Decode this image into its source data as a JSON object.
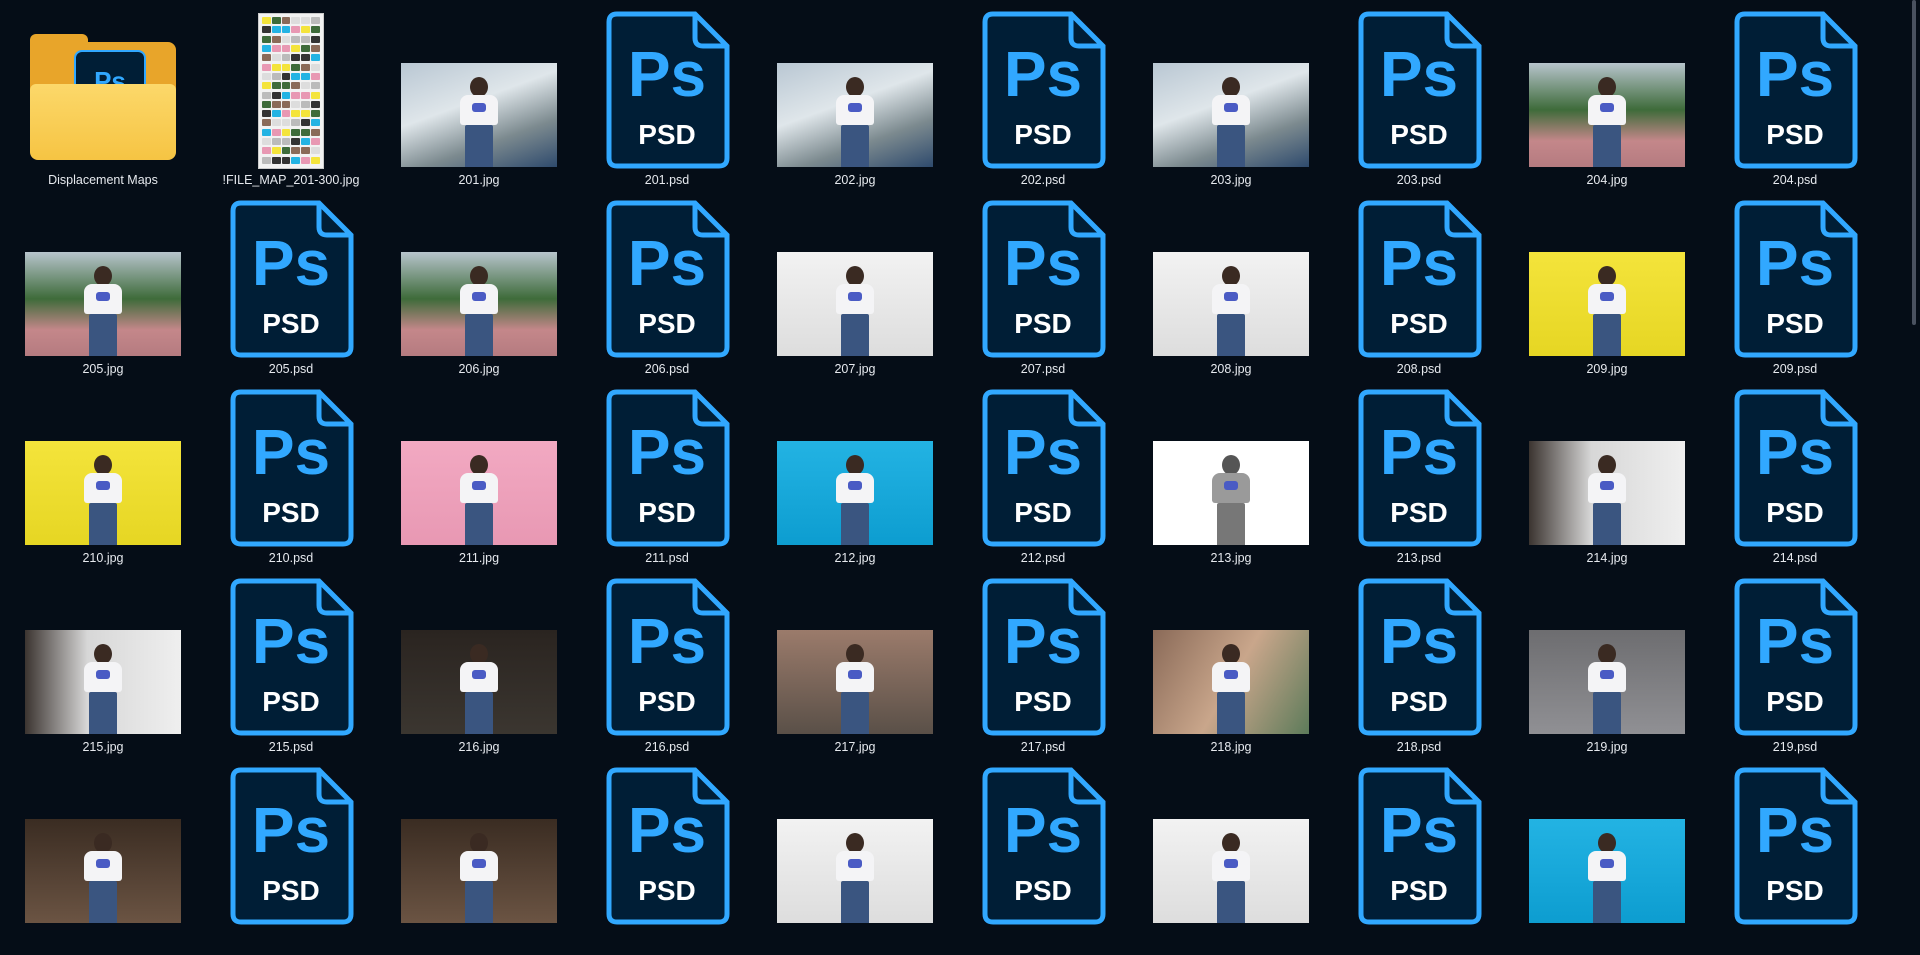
{
  "colors": {
    "background": "#050d17",
    "psd_blue": "#31a8ff",
    "psd_dark": "#001e36",
    "folder_yellow": "#f6c443"
  },
  "psd_icon": {
    "logo_text": "Ps",
    "type_text": "PSD"
  },
  "items": [
    {
      "name": "Displacement Maps",
      "kind": "folder",
      "icon": "ps-folder-icon"
    },
    {
      "name": "!FILE_MAP_201-300.jpg",
      "kind": "filemap"
    },
    {
      "name": "201.jpg",
      "kind": "photo",
      "bg": "ferris"
    },
    {
      "name": "201.psd",
      "kind": "psd"
    },
    {
      "name": "202.jpg",
      "kind": "photo",
      "bg": "ferris"
    },
    {
      "name": "202.psd",
      "kind": "psd"
    },
    {
      "name": "203.jpg",
      "kind": "photo",
      "bg": "ferris"
    },
    {
      "name": "203.psd",
      "kind": "psd"
    },
    {
      "name": "204.jpg",
      "kind": "photo",
      "bg": "park"
    },
    {
      "name": "204.psd",
      "kind": "psd"
    },
    {
      "name": "205.jpg",
      "kind": "photo",
      "bg": "park"
    },
    {
      "name": "205.psd",
      "kind": "psd"
    },
    {
      "name": "206.jpg",
      "kind": "photo",
      "bg": "park"
    },
    {
      "name": "206.psd",
      "kind": "psd"
    },
    {
      "name": "207.jpg",
      "kind": "photo",
      "bg": "white"
    },
    {
      "name": "207.psd",
      "kind": "psd"
    },
    {
      "name": "208.jpg",
      "kind": "photo",
      "bg": "white"
    },
    {
      "name": "208.psd",
      "kind": "psd"
    },
    {
      "name": "209.jpg",
      "kind": "photo",
      "bg": "yellow"
    },
    {
      "name": "209.psd",
      "kind": "psd"
    },
    {
      "name": "210.jpg",
      "kind": "photo",
      "bg": "yellow"
    },
    {
      "name": "210.psd",
      "kind": "psd"
    },
    {
      "name": "211.jpg",
      "kind": "photo",
      "bg": "pink"
    },
    {
      "name": "211.psd",
      "kind": "psd"
    },
    {
      "name": "212.jpg",
      "kind": "photo",
      "bg": "cyan"
    },
    {
      "name": "212.psd",
      "kind": "psd"
    },
    {
      "name": "213.jpg",
      "kind": "photo",
      "bg": "silhouette"
    },
    {
      "name": "213.psd",
      "kind": "psd"
    },
    {
      "name": "214.jpg",
      "kind": "photo",
      "bg": "stairs"
    },
    {
      "name": "214.psd",
      "kind": "psd"
    },
    {
      "name": "215.jpg",
      "kind": "photo",
      "bg": "stairs"
    },
    {
      "name": "215.psd",
      "kind": "psd"
    },
    {
      "name": "216.jpg",
      "kind": "photo",
      "bg": "dark"
    },
    {
      "name": "216.psd",
      "kind": "psd"
    },
    {
      "name": "217.jpg",
      "kind": "photo",
      "bg": "industrial"
    },
    {
      "name": "217.psd",
      "kind": "psd"
    },
    {
      "name": "218.jpg",
      "kind": "photo",
      "bg": "mural"
    },
    {
      "name": "218.psd",
      "kind": "psd"
    },
    {
      "name": "219.jpg",
      "kind": "photo",
      "bg": "graffiti"
    },
    {
      "name": "219.psd",
      "kind": "psd"
    },
    {
      "name": "",
      "kind": "photo",
      "bg": "shelves"
    },
    {
      "name": "",
      "kind": "psd"
    },
    {
      "name": "",
      "kind": "photo",
      "bg": "shelves"
    },
    {
      "name": "",
      "kind": "psd"
    },
    {
      "name": "",
      "kind": "photo",
      "bg": "white"
    },
    {
      "name": "",
      "kind": "psd"
    },
    {
      "name": "",
      "kind": "photo",
      "bg": "white"
    },
    {
      "name": "",
      "kind": "psd"
    },
    {
      "name": "",
      "kind": "photo",
      "bg": "cyan"
    },
    {
      "name": "",
      "kind": "psd"
    }
  ]
}
